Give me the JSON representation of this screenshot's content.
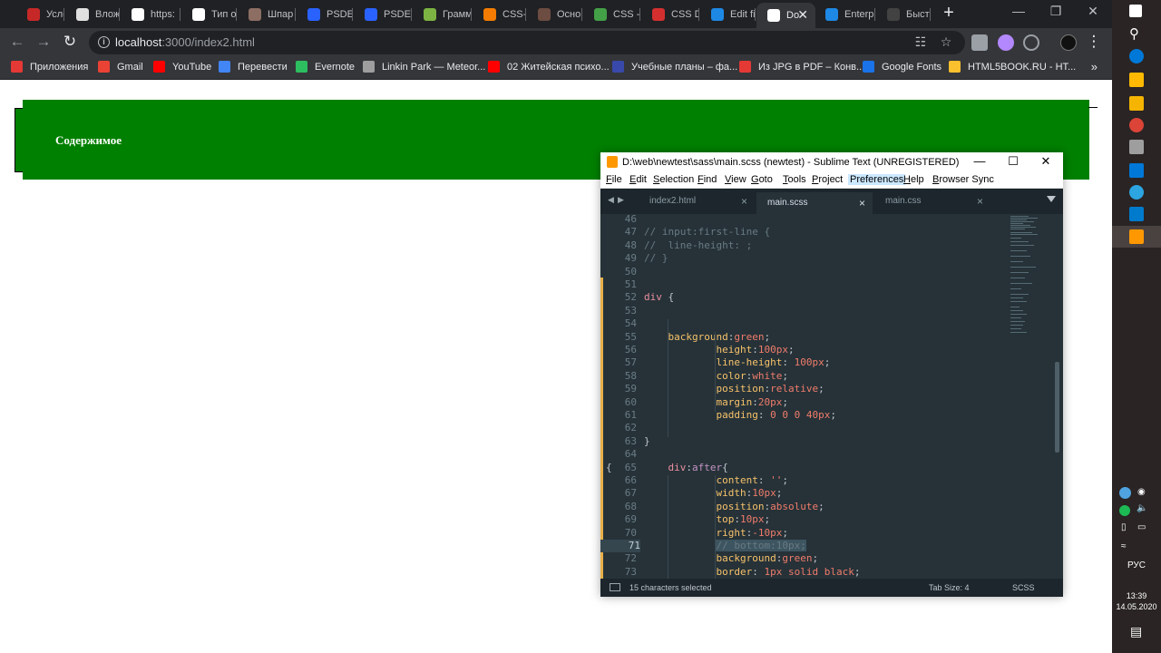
{
  "browser": {
    "tabs": [
      {
        "label": "Услов",
        "color": "#c62828"
      },
      {
        "label": "Вложе",
        "color": "#e0e0e0"
      },
      {
        "label": "https:",
        "color": "#ffffff"
      },
      {
        "label": "Тип о",
        "color": "#ffffff"
      },
      {
        "label": "Шпар",
        "color": "#8d6e63"
      },
      {
        "label": "PSDET",
        "color": "#2962ff"
      },
      {
        "label": "PSDET",
        "color": "#2962ff"
      },
      {
        "label": "Грамм",
        "color": "#7cb342"
      },
      {
        "label": "CSS-U",
        "color": "#f57c00"
      },
      {
        "label": "Основ",
        "color": "#6d4c41"
      },
      {
        "label": "CSS -",
        "color": "#43a047"
      },
      {
        "label": "CSS D",
        "color": "#d32f2f"
      },
      {
        "label": "Edit fi",
        "color": "#1e88e5"
      },
      {
        "label": "Do",
        "color": "#ffffff"
      },
      {
        "label": "Enterp",
        "color": "#1e88e5"
      },
      {
        "label": "Быстр",
        "color": "#424242"
      }
    ],
    "active_tab_index": 13,
    "url_host": "localhost",
    "url_path": ":3000/index2.html",
    "bookmarks": [
      {
        "label": "Приложения",
        "color": "#e53935"
      },
      {
        "label": "Gmail",
        "color": "#ea4335"
      },
      {
        "label": "YouTube",
        "color": "#ff0000"
      },
      {
        "label": "Перевести",
        "color": "#4285f4"
      },
      {
        "label": "Evernote",
        "color": "#2dbe60"
      },
      {
        "label": "Linkin Park — Meteor...",
        "color": "#9e9e9e"
      },
      {
        "label": "02 Житейская психо...",
        "color": "#ff0000"
      },
      {
        "label": "Учебные планы – фа...",
        "color": "#3949ab"
      },
      {
        "label": "Из JPG в PDF – Конв...",
        "color": "#e53935"
      },
      {
        "label": "Google Fonts",
        "color": "#1a73e8"
      },
      {
        "label": "HTML5BOOK.RU - HT...",
        "color": "#fbc02d"
      }
    ]
  },
  "page": {
    "content_text": "Содержимое"
  },
  "sublime": {
    "title": "D:\\web\\newtest\\sass\\main.scss (newtest) - Sublime Text (UNREGISTERED)",
    "menu": [
      {
        "label": "File",
        "u": "F",
        "rest": "ile"
      },
      {
        "label": "Edit",
        "u": "E",
        "rest": "dit"
      },
      {
        "label": "Selection",
        "u": "S",
        "rest": "election"
      },
      {
        "label": "Find",
        "u": "F",
        "rest": "ind"
      },
      {
        "label": "View",
        "u": "V",
        "rest": "iew"
      },
      {
        "label": "Goto",
        "u": "G",
        "rest": "oto"
      },
      {
        "label": "Tools",
        "u": "T",
        "rest": "ools"
      },
      {
        "label": "Project",
        "u": "P",
        "rest": "roject"
      },
      {
        "label": "Preferences",
        "u": "",
        "rest": "Preferences"
      },
      {
        "label": "Help",
        "u": "H",
        "rest": "elp"
      },
      {
        "label": "Browser Sync",
        "u": "B",
        "rest": "rowser Sync"
      }
    ],
    "tabs": [
      "index2.html",
      "main.scss",
      "main.css"
    ],
    "active_tab": 1,
    "lines": [
      {
        "n": "46",
        "parts": []
      },
      {
        "n": "47",
        "parts": [
          [
            "c-cm",
            "// input:first-line {"
          ]
        ]
      },
      {
        "n": "48",
        "parts": [
          [
            "c-cm",
            "//  line-height: ;"
          ]
        ]
      },
      {
        "n": "49",
        "parts": [
          [
            "c-cm",
            "// }"
          ]
        ]
      },
      {
        "n": "50",
        "parts": []
      },
      {
        "n": "51",
        "parts": []
      },
      {
        "n": "52",
        "parts": [
          [
            "c-sel",
            "div"
          ],
          [
            "c-pn",
            " {"
          ]
        ]
      },
      {
        "n": "53",
        "parts": []
      },
      {
        "n": "54",
        "parts": []
      },
      {
        "n": "55",
        "parts": [
          [
            "c-pn",
            "    "
          ],
          [
            "c-pr",
            "background"
          ],
          [
            "c-pn",
            ":"
          ],
          [
            "c-val",
            "green"
          ],
          [
            "c-pn",
            ";"
          ]
        ]
      },
      {
        "n": "56",
        "parts": [
          [
            "c-pn",
            "            "
          ],
          [
            "c-pr",
            "height"
          ],
          [
            "c-pn",
            ":"
          ],
          [
            "c-val",
            "100px"
          ],
          [
            "c-pn",
            ";"
          ]
        ]
      },
      {
        "n": "57",
        "parts": [
          [
            "c-pn",
            "            "
          ],
          [
            "c-pr",
            "line-height"
          ],
          [
            "c-pn",
            ": "
          ],
          [
            "c-val",
            "100px"
          ],
          [
            "c-pn",
            ";"
          ]
        ]
      },
      {
        "n": "58",
        "parts": [
          [
            "c-pn",
            "            "
          ],
          [
            "c-pr",
            "color"
          ],
          [
            "c-pn",
            ":"
          ],
          [
            "c-val",
            "white"
          ],
          [
            "c-pn",
            ";"
          ]
        ]
      },
      {
        "n": "59",
        "parts": [
          [
            "c-pn",
            "            "
          ],
          [
            "c-pr",
            "position"
          ],
          [
            "c-pn",
            ":"
          ],
          [
            "c-val",
            "relative"
          ],
          [
            "c-pn",
            ";"
          ]
        ]
      },
      {
        "n": "60",
        "parts": [
          [
            "c-pn",
            "            "
          ],
          [
            "c-pr",
            "margin"
          ],
          [
            "c-pn",
            ":"
          ],
          [
            "c-val",
            "20px"
          ],
          [
            "c-pn",
            ";"
          ]
        ]
      },
      {
        "n": "61",
        "parts": [
          [
            "c-pn",
            "            "
          ],
          [
            "c-pr",
            "padding"
          ],
          [
            "c-pn",
            ": "
          ],
          [
            "c-val",
            "0 0 0 40px"
          ],
          [
            "c-pn",
            ";"
          ]
        ]
      },
      {
        "n": "62",
        "parts": []
      },
      {
        "n": "63",
        "parts": [
          [
            "c-pn",
            "}"
          ]
        ]
      },
      {
        "n": "64",
        "parts": []
      },
      {
        "n": "65",
        "parts": [
          [
            "c-pn",
            "    "
          ],
          [
            "c-sel",
            "div"
          ],
          [
            "c-pn",
            ":"
          ],
          [
            "c-ps",
            "after"
          ],
          [
            "c-pn",
            "{"
          ]
        ],
        "fold": "{"
      },
      {
        "n": "66",
        "parts": [
          [
            "c-pn",
            "            "
          ],
          [
            "c-pr",
            "content"
          ],
          [
            "c-pn",
            ": "
          ],
          [
            "c-val",
            "''"
          ],
          [
            "c-pn",
            ";"
          ]
        ]
      },
      {
        "n": "67",
        "parts": [
          [
            "c-pn",
            "            "
          ],
          [
            "c-pr",
            "width"
          ],
          [
            "c-pn",
            ":"
          ],
          [
            "c-val",
            "10px"
          ],
          [
            "c-pn",
            ";"
          ]
        ]
      },
      {
        "n": "68",
        "parts": [
          [
            "c-pn",
            "            "
          ],
          [
            "c-pr",
            "position"
          ],
          [
            "c-pn",
            ":"
          ],
          [
            "c-val",
            "absolute"
          ],
          [
            "c-pn",
            ";"
          ]
        ]
      },
      {
        "n": "69",
        "parts": [
          [
            "c-pn",
            "            "
          ],
          [
            "c-pr",
            "top"
          ],
          [
            "c-pn",
            ":"
          ],
          [
            "c-val",
            "10px"
          ],
          [
            "c-pn",
            ";"
          ]
        ]
      },
      {
        "n": "70",
        "parts": [
          [
            "c-pn",
            "            "
          ],
          [
            "c-pr",
            "right"
          ],
          [
            "c-pn",
            ":"
          ],
          [
            "c-val",
            "-10px"
          ],
          [
            "c-pn",
            ";"
          ]
        ]
      },
      {
        "n": "71",
        "parts": [
          [
            "c-pn",
            "            "
          ],
          [
            "c-cm selbg",
            "// bottom:10px;"
          ]
        ],
        "current": true
      },
      {
        "n": "72",
        "parts": [
          [
            "c-pn",
            "            "
          ],
          [
            "c-pr",
            "background"
          ],
          [
            "c-pn",
            ":"
          ],
          [
            "c-val",
            "green"
          ],
          [
            "c-pn",
            ";"
          ]
        ]
      },
      {
        "n": "73",
        "parts": [
          [
            "c-pn",
            "            "
          ],
          [
            "c-pr",
            "border"
          ],
          [
            "c-pn",
            ": "
          ],
          [
            "c-val",
            "1px solid black"
          ],
          [
            "c-pn",
            ";"
          ]
        ]
      }
    ],
    "status_selection": "15 characters selected",
    "status_tabsize": "Tab Size: 4",
    "status_syntax": "SCSS"
  },
  "taskbar": {
    "lang": "РУС",
    "time": "13:39",
    "date": "14.05.2020"
  }
}
